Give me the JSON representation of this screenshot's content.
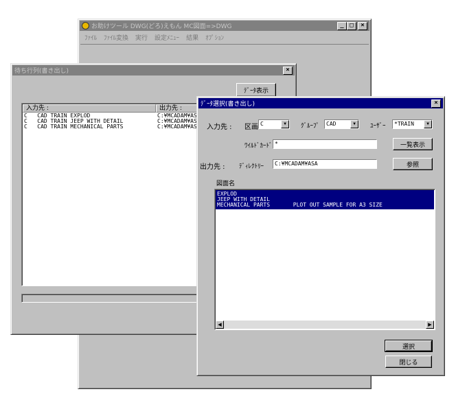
{
  "main_window": {
    "title": "お助けツール DWG(どろ)えもん MC図面=>DWG",
    "menu": [
      "ﾌｧｲﾙ",
      "ﾌｧｲﾙ変換",
      "実行",
      "設定ﾒﾆｭｰ",
      "結果",
      "ｵﾌﾟｼｮﾝ"
    ],
    "controls": [
      "_",
      "□",
      "×"
    ]
  },
  "queue_window": {
    "title": "待ち行列(書き出し)",
    "close": "×",
    "data_display_button": "ﾃﾞｰﾀ表示",
    "columns": [
      "入力先 :",
      "出力先 :"
    ],
    "rows": [
      {
        "input": "C   CAD TRAIN EXPLOD",
        "output": "C:¥MCADAM¥ASA"
      },
      {
        "input": "C   CAD TRAIN JEEP WITH DETAIL",
        "output": "C:¥MCADAM¥ASA"
      },
      {
        "input": "C   CAD TRAIN MECHANICAL PARTS",
        "output": "C:¥MCADAM¥ASA"
      }
    ]
  },
  "select_dialog": {
    "title": "ﾃﾞｰﾀ選択(書き出し)",
    "close": "×",
    "input_label": "入力先 :",
    "drawing_label": "区画",
    "drawing_value": "C",
    "group_label": "ｸﾞﾙｰﾌﾟ",
    "group_value": "CAD",
    "user_label": "ﾕｰｻﾞｰ",
    "user_value": "*TRAIN",
    "wildcard_label": "ﾜｲﾙﾄﾞｶｰﾄﾞ",
    "wildcard_value": "*",
    "list_button": "一覧表示",
    "output_label": "出力先 :",
    "directory_label": "ﾃﾞｨﾚｸﾄﾘｰ",
    "directory_value": "C:¥MCADAM¥ASA",
    "browse_button": "参照",
    "drawing_name_label": "図面名",
    "items": [
      "EXPLOD",
      "JEEP WITH DETAIL",
      "MECHANICAL PARTS       PLOT OUT SAMPLE FOR A3 SIZE"
    ],
    "select_button": "選択",
    "close_button": "閉じる"
  },
  "colors": {
    "window_bg": "#c0c0c0",
    "active_title": "#000080",
    "inactive_title": "#808080",
    "selection": "#000080"
  }
}
